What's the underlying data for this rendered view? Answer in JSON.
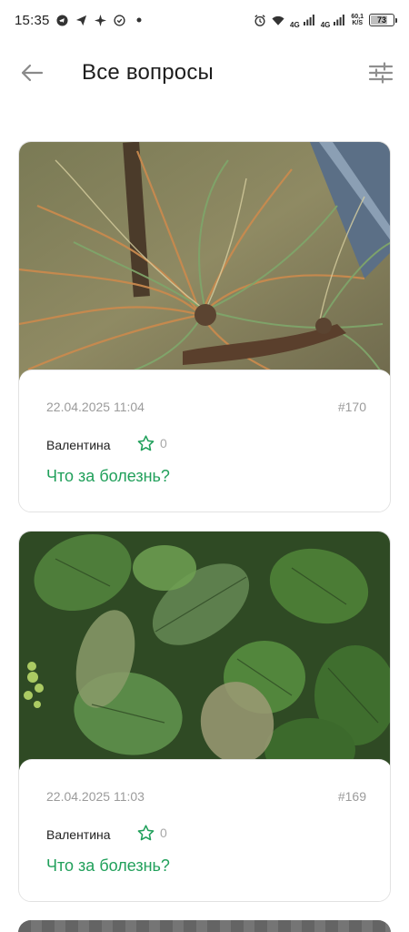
{
  "status_bar": {
    "time": "15:35",
    "left_icons": [
      "telegram-icon",
      "send-icon",
      "sparkle-icon",
      "check-circle-icon",
      "dot-icon"
    ],
    "network_1": "4G",
    "network_2": "4G",
    "speed_value": "60,1",
    "speed_unit": "K/S",
    "battery": "73",
    "battery_level": 0.73
  },
  "header": {
    "title": "Все вопросы",
    "back_icon": "arrow-left-icon",
    "filter_icon": "sliders-icon"
  },
  "colors": {
    "accent": "#21a05b",
    "muted_text": "#9b9b9b",
    "title_text": "#1d1d1d"
  },
  "questions": [
    {
      "date": "22.04.2025 11:04",
      "number": "#170",
      "author": "Валентина",
      "favorites": "0",
      "title": "Что за болезнь?",
      "photo": "pine-needles-photo"
    },
    {
      "date": "22.04.2025 11:03",
      "number": "#169",
      "author": "Валентина",
      "favorites": "0",
      "title": "Что за болезнь?",
      "photo": "hydrangea-leaves-photo"
    }
  ]
}
